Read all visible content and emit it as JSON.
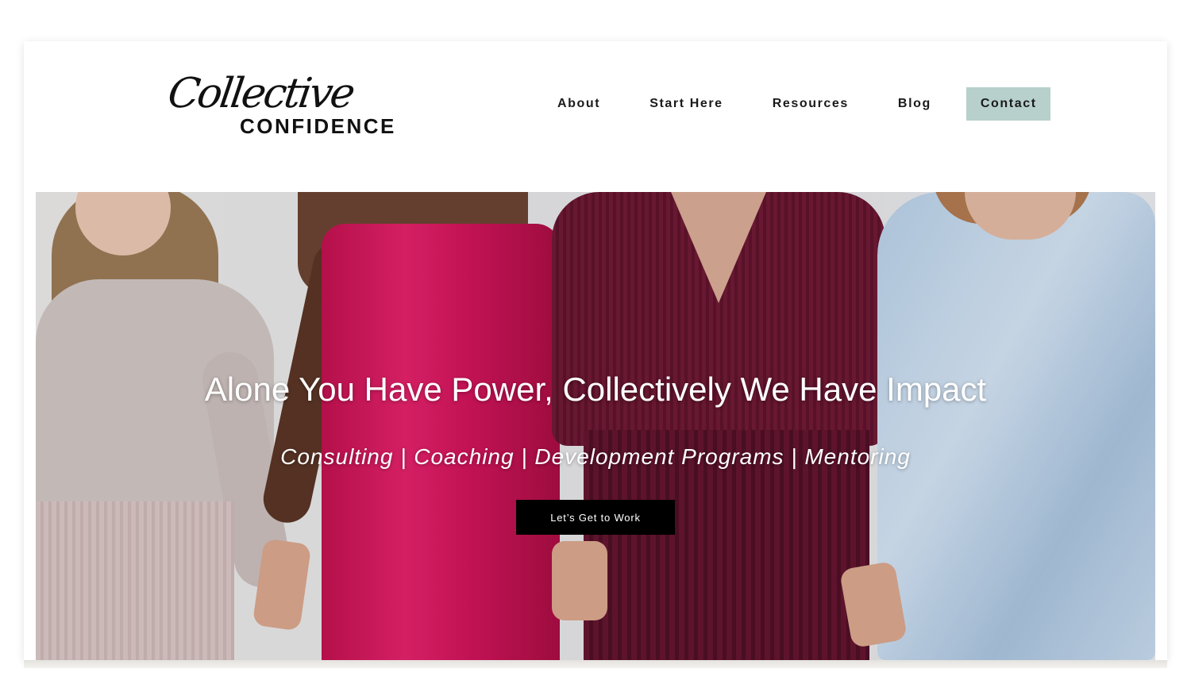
{
  "brand": {
    "script_text": "Collective",
    "word_text": "CONFIDENCE"
  },
  "nav": {
    "items": [
      {
        "label": "About"
      },
      {
        "label": "Start Here"
      },
      {
        "label": "Resources"
      },
      {
        "label": "Blog"
      },
      {
        "label": "Contact"
      }
    ],
    "contact_bg": "#b7d0cc"
  },
  "hero": {
    "title": "Alone You Have Power, Collectively We Have Impact",
    "subtitle": "Consulting | Coaching | Development Programs | Mentoring",
    "cta_label": "Let’s Get to Work"
  }
}
